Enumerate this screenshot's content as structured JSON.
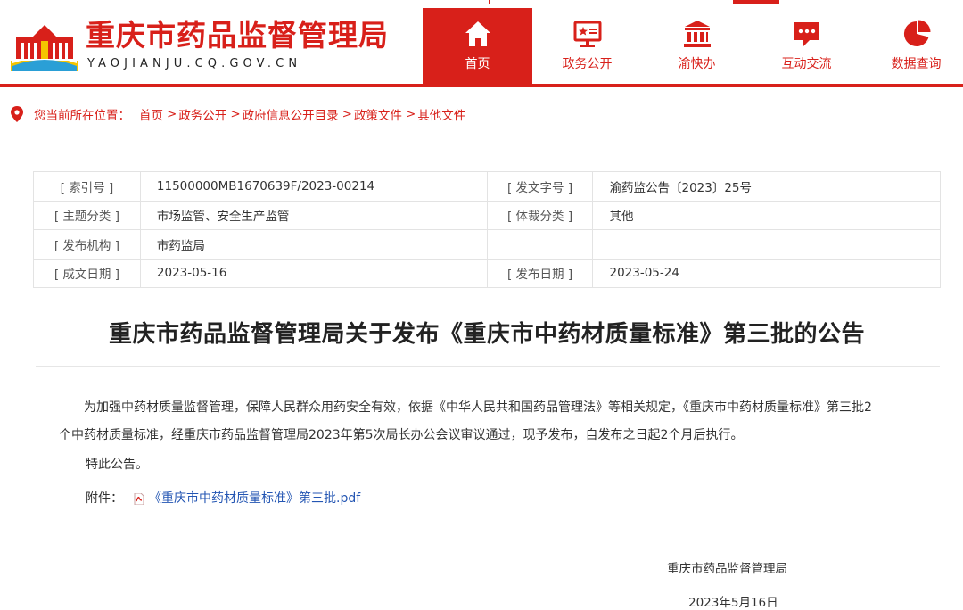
{
  "header": {
    "site_title": "重庆市药品监督管理局",
    "site_domain": "YAOJIANJU.CQ.GOV.CN",
    "nav": [
      {
        "label": "首页",
        "icon": "home-icon",
        "active": true
      },
      {
        "label": "政务公开",
        "icon": "monitor-star-icon",
        "active": false
      },
      {
        "label": "渝快办",
        "icon": "building-icon",
        "active": false
      },
      {
        "label": "互动交流",
        "icon": "chat-bubble-icon",
        "active": false
      },
      {
        "label": "数据查询",
        "icon": "pie-chart-icon",
        "active": false
      }
    ],
    "brand_color": "#d8201a"
  },
  "breadcrumb": {
    "prefix": "您当前所在位置：",
    "items": [
      "首页",
      "政务公开",
      "政府信息公开目录",
      "政策文件",
      "其他文件"
    ],
    "separator": ">"
  },
  "meta": {
    "rows": [
      {
        "k1": "[ 索引号 ]",
        "v1": "11500000MB1670639F/2023-00214",
        "k2": "[ 发文字号 ]",
        "v2": "渝药监公告〔2023〕25号"
      },
      {
        "k1": "[ 主题分类 ]",
        "v1": "市场监管、安全生产监管",
        "k2": "[ 体裁分类 ]",
        "v2": "其他"
      },
      {
        "k1": "[ 发布机构 ]",
        "v1": "市药监局",
        "k2": "",
        "v2": ""
      },
      {
        "k1": "[ 成文日期 ]",
        "v1": "2023-05-16",
        "k2": "[ 发布日期 ]",
        "v2": "2023-05-24"
      }
    ]
  },
  "article": {
    "title": "重庆市药品监督管理局关于发布《重庆市中药材质量标准》第三批的公告",
    "paragraph_lines": [
      "为加强中药材质量监督管理，保障人民群众用药安全有效，依据《中华人民共和国药品管理法》等相关规定，《重庆市中药材质量标准》第三批2",
      "个中药材质量标准，经重庆市药品监督管理局2023年第5次局长办公会议审议通过，现予发布，自发布之日起2个月后执行。"
    ],
    "closing": "特此公告。",
    "attachment_label": "附件：",
    "attachment_link": "《重庆市中药材质量标准》第三批.pdf",
    "signature": "重庆市药品监督管理局",
    "sign_date": "2023年5月16日"
  }
}
